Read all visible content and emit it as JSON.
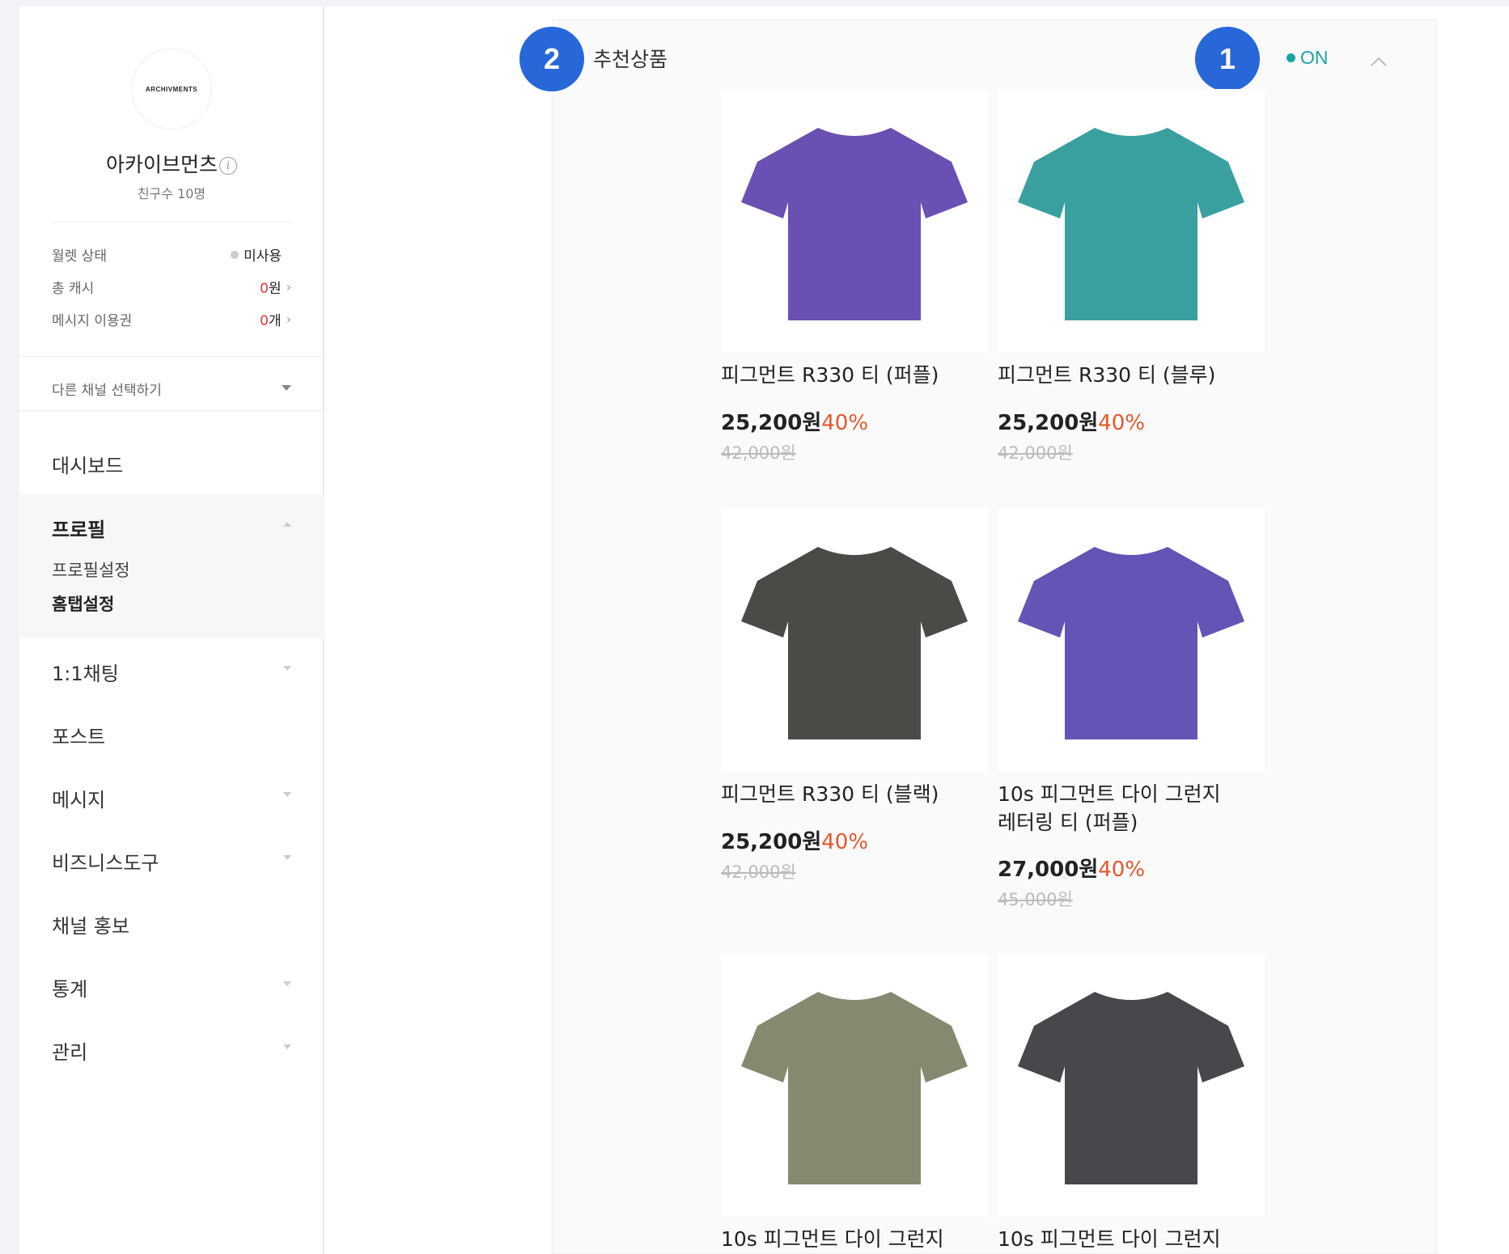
{
  "profile": {
    "logo_text": "ARCHIVMENTS",
    "channel_name": "아카이브먼츠",
    "friends": "친구수 10명",
    "stats": [
      {
        "label": "월렛 상태",
        "value": "미사용",
        "status_dot": "grey"
      },
      {
        "label": "총 캐시",
        "value_num": "0",
        "value_unit": "원"
      },
      {
        "label": "메시지 이용권",
        "value_num": "0",
        "value_unit": "개"
      }
    ],
    "channel_select": "다른 채널 선택하기"
  },
  "menu": {
    "dashboard": "대시보드",
    "profile": "프로필",
    "profile_sub": [
      "프로필설정",
      "홈탭설정"
    ],
    "chat": "1:1채팅",
    "post": "포스트",
    "message": "메시지",
    "biz_tools": "비즈니스도구",
    "promotion": "채널 홍보",
    "stats": "통계",
    "manage": "관리"
  },
  "section": {
    "title": "추천상품",
    "toggle_label": "ON",
    "badges": [
      "2",
      "1"
    ],
    "accent_color": "#2767d8",
    "on_color": "#1aa5a5"
  },
  "products": [
    {
      "name": "피그먼트 R330 티 (퍼플)",
      "price": "25,200원",
      "discount": "40%",
      "original": "42,000원",
      "color": "#6a50b3"
    },
    {
      "name": "피그먼트 R330 티 (블루)",
      "price": "25,200원",
      "discount": "40%",
      "original": "42,000원",
      "color": "#3a9f9f"
    },
    {
      "name": "피그먼트 R330 티 (블랙)",
      "price": "25,200원",
      "discount": "40%",
      "original": "42,000원",
      "color": "#4b4a47"
    },
    {
      "name": "10s 피그먼트 다이 그런지\n레터링 티 (퍼플)",
      "price": "27,000원",
      "discount": "40%",
      "original": "45,000원",
      "color": "#6454b5"
    },
    {
      "name": "10s 피그먼트 다이 그런지",
      "color": "#848a70"
    },
    {
      "name": "10s 피그먼트 다이 그런지",
      "color": "#47484b"
    }
  ]
}
